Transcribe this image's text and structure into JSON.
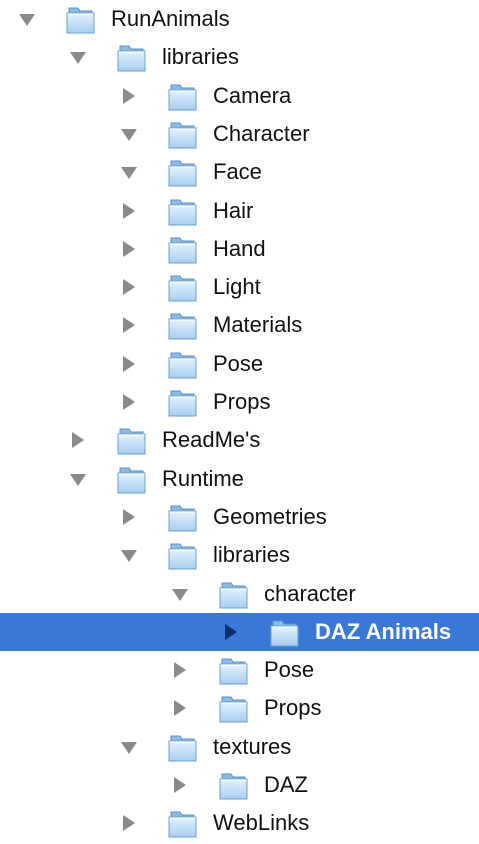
{
  "tree": {
    "selection_color": "#3a78d8",
    "folder_icon": "folder-icon",
    "items": [
      {
        "label": "RunAnimals",
        "depth": 0,
        "state": "expanded"
      },
      {
        "label": "libraries",
        "depth": 1,
        "state": "expanded"
      },
      {
        "label": "Camera",
        "depth": 2,
        "state": "collapsed"
      },
      {
        "label": "Character",
        "depth": 2,
        "state": "expanded"
      },
      {
        "label": "Face",
        "depth": 2,
        "state": "expanded"
      },
      {
        "label": "Hair",
        "depth": 2,
        "state": "collapsed"
      },
      {
        "label": "Hand",
        "depth": 2,
        "state": "collapsed"
      },
      {
        "label": "Light",
        "depth": 2,
        "state": "collapsed"
      },
      {
        "label": "Materials",
        "depth": 2,
        "state": "collapsed"
      },
      {
        "label": "Pose",
        "depth": 2,
        "state": "collapsed"
      },
      {
        "label": "Props",
        "depth": 2,
        "state": "collapsed"
      },
      {
        "label": "ReadMe's",
        "depth": 1,
        "state": "collapsed"
      },
      {
        "label": "Runtime",
        "depth": 1,
        "state": "expanded"
      },
      {
        "label": "Geometries",
        "depth": 2,
        "state": "collapsed"
      },
      {
        "label": "libraries",
        "depth": 2,
        "state": "expanded"
      },
      {
        "label": "character",
        "depth": 3,
        "state": "expanded"
      },
      {
        "label": "DAZ Animals",
        "depth": 4,
        "state": "collapsed",
        "selected": true
      },
      {
        "label": "Pose",
        "depth": 3,
        "state": "collapsed"
      },
      {
        "label": "Props",
        "depth": 3,
        "state": "collapsed"
      },
      {
        "label": "textures",
        "depth": 2,
        "state": "expanded"
      },
      {
        "label": "DAZ",
        "depth": 3,
        "state": "collapsed"
      },
      {
        "label": "WebLinks",
        "depth": 2,
        "state": "collapsed"
      }
    ]
  }
}
